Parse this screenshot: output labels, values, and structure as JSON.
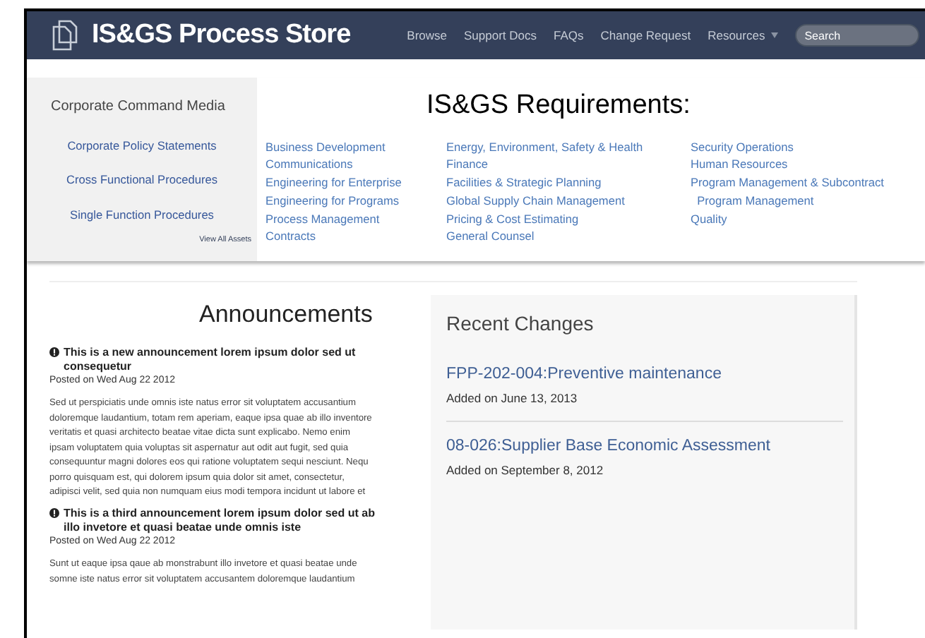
{
  "navbar": {
    "brand": "IS&GS Process Store",
    "links": [
      "Browse",
      "Support Docs",
      "FAQs",
      "Change Request",
      "Resources"
    ],
    "search": {
      "placeholder": "Search"
    }
  },
  "sidebar": {
    "title": "Corporate Command Media",
    "links": [
      "Corporate Policy Statements",
      "Cross Functional Procedures",
      "Single Function Procedures"
    ],
    "view_all": "View All Assets"
  },
  "requirements": {
    "title": "IS&GS Requirements:",
    "columns": [
      [
        "Business Development",
        "Communications",
        "Engineering for Enterprise",
        "Engineering for Programs",
        "Process Management",
        "Contracts"
      ],
      [
        "Energy, Environment, Safety & Health",
        "Finance",
        "Facilities & Strategic Planning",
        "Global Supply Chain Management",
        "Pricing & Cost Estimating",
        "General Counsel"
      ],
      [
        "Security Operations",
        "Human Resources",
        "Program Management & Subcontract",
        "  Program Management",
        "Quality"
      ]
    ]
  },
  "announcements": {
    "title": "Announcements",
    "items": [
      {
        "title": "This is a new announcement lorem ipsum dolor sed ut consequetur",
        "posted": "Posted on Wed Aug 22 2012",
        "lines": [
          "Sed ut perspiciatis unde omnis iste natus error sit voluptatem accusantium",
          "doloremque laudantium, totam rem aperiam, eaque ipsa quae ab illo inventore",
          "veritatis et quasi architecto beatae vitae dicta sunt explicabo. Nemo enim",
          "ipsam voluptatem quia voluptas sit aspernatur aut odit aut fugit, sed quia",
          "consequuntur magni dolores eos qui ratione voluptatem sequi nesciunt. Nequ",
          "porro quisquam est, qui dolorem ipsum quia dolor sit amet, consectetur,",
          "adipisci velit, sed quia non numquam eius modi tempora incidunt ut labore et"
        ]
      },
      {
        "title": "This is a third announcement lorem ipsum dolor sed ut ab illo invetore et quasi beatae unde omnis iste",
        "posted": "Posted on Wed Aug 22 2012",
        "lines": [
          "Sunt ut eaque ipsa qaue ab monstrabunt illo invetore et quasi beatae unde",
          "somne iste natus error sit voluptatem accusantem doloremque laudantium"
        ]
      }
    ]
  },
  "recent_changes": {
    "title": "Recent Changes",
    "items": [
      {
        "title": "FPP-202-004:Preventive maintenance",
        "added": "Added on June 13, 2013"
      },
      {
        "title": "08-026:Supplier Base Economic Assessment",
        "added": "Added on September 8, 2012"
      }
    ]
  }
}
